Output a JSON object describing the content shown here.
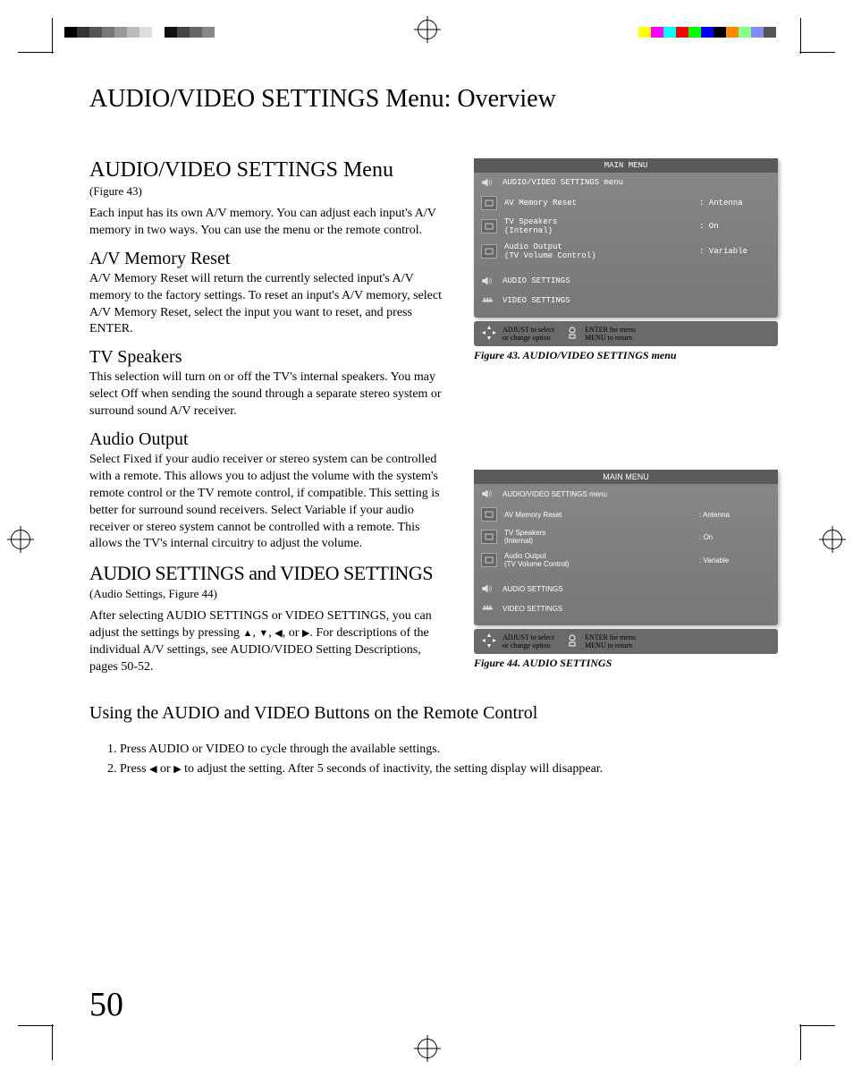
{
  "colorbar_left": [
    "#000000",
    "#333333",
    "#555555",
    "#777777",
    "#999999",
    "#bbbbbb",
    "#dddddd",
    "#ffffff",
    "#111111",
    "#444444",
    "#666666",
    "#888888"
  ],
  "colorbar_right": [
    "#ffff00",
    "#ff00ff",
    "#00ffff",
    "#ff0000",
    "#00ff00",
    "#0000ff",
    "#000000",
    "#ff8800",
    "#88ff88",
    "#8888ff",
    "#555555",
    "#ffffff"
  ],
  "page_title": "AUDIO/VIDEO SETTINGS Menu: Overview",
  "s1": {
    "heading": "AUDIO/VIDEO SETTINGS Menu",
    "figref": "(Figure 43)",
    "body": "Each input has its own A/V memory.  You can adjust each input's A/V memory in two ways.  You can use the menu or the remote control."
  },
  "s2": {
    "heading": "A/V Memory Reset",
    "body": "A/V Memory Reset will return the currently selected input's A/V memory to the factory settings.  To reset an input's A/V memory, select A/V Memory Reset, select the input you want to reset, and press ENTER."
  },
  "s3": {
    "heading": "TV Speakers",
    "body": "This selection will turn on or off the TV's internal speakers.  You may select Off when sending the sound through a separate stereo system or surround sound A/V receiver."
  },
  "s4": {
    "heading": "Audio Output",
    "body": "Select Fixed if your audio receiver or stereo system can be controlled with a remote.  This allows you to adjust the volume with the system's remote control or the TV remote control, if compatible.  This setting is better for surround sound receivers.  Select Variable if your audio receiver or stereo system cannot be controlled with a remote.  This allows the TV's internal circuitry to adjust the volume."
  },
  "s5": {
    "heading": "AUDIO SETTINGS  and VIDEO SETTINGS",
    "figref": "(Audio Settings, Figure 44)",
    "body_a": "After selecting AUDIO SETTINGS or VIDEO SETTINGS, you can adjust the settings by pressing ",
    "body_b": ".  For descriptions of the individual A/V settings, see AUDIO/VIDEO Setting Descriptions, pages 50-52."
  },
  "menu43": {
    "title": "MAIN MENU",
    "r1": "AUDIO/VIDEO SETTINGS menu",
    "r2_label": "AV Memory Reset",
    "r2_value": ": Antenna",
    "r3_label": "TV Speakers\n(Internal)",
    "r3_value": ": On",
    "r4_label": "Audio Output\n(TV Volume Control)",
    "r4_value": ": Variable",
    "r5": "AUDIO SETTINGS",
    "r6": "VIDEO SETTINGS",
    "foot_a": "ADJUST to select",
    "foot_b": "ENTER for menu",
    "foot_c": "or change option",
    "foot_d": "MENU to return",
    "caption": "Figure 43. AUDIO/VIDEO SETTINGS menu"
  },
  "menu44": {
    "title": "MAIN MENU",
    "r1": "AUDIO/VIDEO SETTINGS menu",
    "r2_label": "AV Memory Reset",
    "r2_value": ": Antenna",
    "r3_label": "TV Speakers\n(Internal)",
    "r3_value": ": On",
    "r4_label": "Audio Output\n(TV Volume Control)",
    "r4_value": ": Variable",
    "r5": "AUDIO SETTINGS",
    "r6": "VIDEO SETTINGS",
    "foot_a": "ADJUST to select",
    "foot_b": "ENTER for menu",
    "foot_c": "or change option",
    "foot_d": "MENU to return",
    "caption": "Figure 44.  AUDIO SETTINGS"
  },
  "remote": {
    "heading": "Using the AUDIO and VIDEO Buttons on the Remote Control",
    "step1": "1.  Press AUDIO or VIDEO to cycle through the  available settings.",
    "step2_a": "2. Press ",
    "step2_b": " or ",
    "step2_c": " to adjust the setting.  After 5 seconds of inactivity, the setting display will disappear."
  },
  "page_number": "50"
}
